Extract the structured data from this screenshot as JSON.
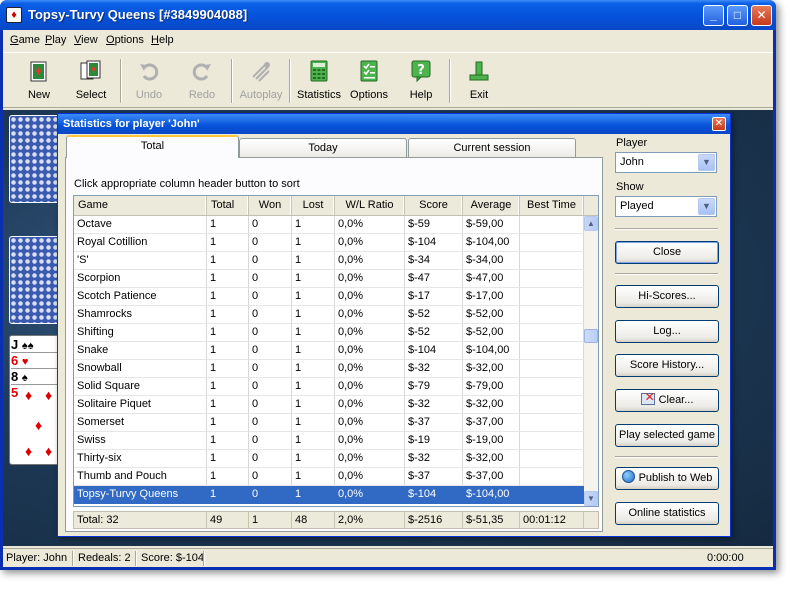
{
  "window": {
    "title": "Topsy-Turvy Queens [#3849904088]",
    "minimize": "_",
    "maximize": "□",
    "close": "✕"
  },
  "menu": [
    {
      "label": "Game",
      "accel": "G",
      "rest": "ame"
    },
    {
      "label": "Play",
      "accel": "P",
      "rest": "lay"
    },
    {
      "label": "View",
      "accel": "V",
      "rest": "iew"
    },
    {
      "label": "Options",
      "accel": "O",
      "rest": "ptions"
    },
    {
      "label": "Help",
      "accel": "H",
      "rest": "elp"
    }
  ],
  "toolbar": {
    "new": "New",
    "select": "Select",
    "undo": "Undo",
    "redo": "Redo",
    "autoplay": "Autoplay",
    "statistics": "Statistics",
    "options": "Options",
    "help": "Help",
    "exit": "Exit"
  },
  "cards": {
    "jack": "J",
    "six": "6",
    "eight": "8",
    "five": "5"
  },
  "status": {
    "player": "Player: John",
    "redeals": "Redeals: 2",
    "score": "Score: $-104",
    "time": "0:00:00"
  },
  "dialog": {
    "title": "Statistics for player 'John'",
    "close": "✕",
    "tabs": {
      "total": "Total",
      "today": "Today",
      "session": "Current session"
    },
    "hint": "Click appropriate column header button to sort",
    "columns": [
      "Game",
      "Total",
      "Won",
      "Lost",
      "W/L Ratio",
      "Score",
      "Average",
      "Best Time"
    ],
    "rows": [
      [
        "Octave",
        "1",
        "0",
        "1",
        "0,0%",
        "$-59",
        "$-59,00",
        ""
      ],
      [
        "Royal Cotillion",
        "1",
        "0",
        "1",
        "0,0%",
        "$-104",
        "$-104,00",
        ""
      ],
      [
        "'S'",
        "1",
        "0",
        "1",
        "0,0%",
        "$-34",
        "$-34,00",
        ""
      ],
      [
        "Scorpion",
        "1",
        "0",
        "1",
        "0,0%",
        "$-47",
        "$-47,00",
        ""
      ],
      [
        "Scotch Patience",
        "1",
        "0",
        "1",
        "0,0%",
        "$-17",
        "$-17,00",
        ""
      ],
      [
        "Shamrocks",
        "1",
        "0",
        "1",
        "0,0%",
        "$-52",
        "$-52,00",
        ""
      ],
      [
        "Shifting",
        "1",
        "0",
        "1",
        "0,0%",
        "$-52",
        "$-52,00",
        ""
      ],
      [
        "Snake",
        "1",
        "0",
        "1",
        "0,0%",
        "$-104",
        "$-104,00",
        ""
      ],
      [
        "Snowball",
        "1",
        "0",
        "1",
        "0,0%",
        "$-32",
        "$-32,00",
        ""
      ],
      [
        "Solid Square",
        "1",
        "0",
        "1",
        "0,0%",
        "$-79",
        "$-79,00",
        ""
      ],
      [
        "Solitaire Piquet",
        "1",
        "0",
        "1",
        "0,0%",
        "$-32",
        "$-32,00",
        ""
      ],
      [
        "Somerset",
        "1",
        "0",
        "1",
        "0,0%",
        "$-37",
        "$-37,00",
        ""
      ],
      [
        "Swiss",
        "1",
        "0",
        "1",
        "0,0%",
        "$-19",
        "$-19,00",
        ""
      ],
      [
        "Thirty-six",
        "1",
        "0",
        "1",
        "0,0%",
        "$-32",
        "$-32,00",
        ""
      ],
      [
        "Thumb and Pouch",
        "1",
        "0",
        "1",
        "0,0%",
        "$-37",
        "$-37,00",
        ""
      ],
      [
        "Topsy-Turvy Queens",
        "1",
        "0",
        "1",
        "0,0%",
        "$-104",
        "$-104,00",
        ""
      ]
    ],
    "selected_row": 15,
    "totals": [
      "Total: 32",
      "49",
      "1",
      "48",
      "2,0%",
      "$-2516",
      "$-51,35",
      "00:01:12"
    ],
    "player_label": "Player",
    "player_value": "John",
    "show_label": "Show",
    "show_value": "Played",
    "buttons": {
      "close": "Close",
      "hiscores": "Hi-Scores...",
      "log": "Log...",
      "score_history": "Score History...",
      "clear": "Clear...",
      "play_selected": "Play selected game",
      "publish": "Publish to Web",
      "online": "Online statistics"
    }
  },
  "colors": {
    "selection": "#316ac5",
    "titlebar": "#0551d9",
    "dialog_bg": "#ece9d8"
  }
}
